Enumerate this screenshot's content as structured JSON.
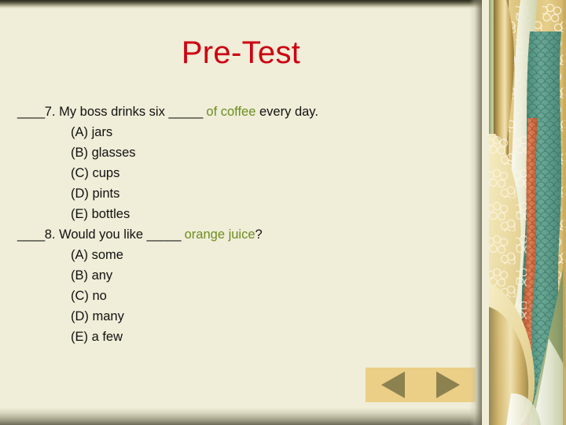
{
  "slide": {
    "title": "Pre-Test",
    "title_color": "#cc0011",
    "background_color": "#f0edd8",
    "highlight_color": "#6b8e20",
    "text_color": "#111111"
  },
  "questions": [
    {
      "blank": "____",
      "number": "7.",
      "stem_before": " My boss drinks six ",
      "stem_blank": "_____",
      "stem_highlight": " of coffee",
      "stem_after": " every day.",
      "options": [
        "(A) jars",
        "(B) glasses",
        "(C) cups",
        "(D) pints",
        "(E) bottles"
      ]
    },
    {
      "blank": "____",
      "number": "8.",
      "stem_before": " Would you like ",
      "stem_blank": "_____",
      "stem_highlight": " orange juice",
      "stem_after": "?",
      "options": [
        "(A) some",
        "(B) any",
        "(C) no",
        "(D) many",
        "(E) a few"
      ]
    }
  ],
  "navigation": {
    "previous_label": "",
    "next_label": "",
    "previous_icon": "triangle-left-icon",
    "next_icon": "triangle-right-icon",
    "bar_color": "#ebcf86",
    "arrow_color": "#8c8250"
  },
  "decoration": {
    "name": "asian-floral-ribbon-border",
    "colors": {
      "gold": "#dfc77e",
      "gold_dark": "#b79a4c",
      "sage": "#b9c294",
      "teal": "#5b9d8c",
      "coral": "#d9714a",
      "cream": "#f2efe0"
    }
  }
}
